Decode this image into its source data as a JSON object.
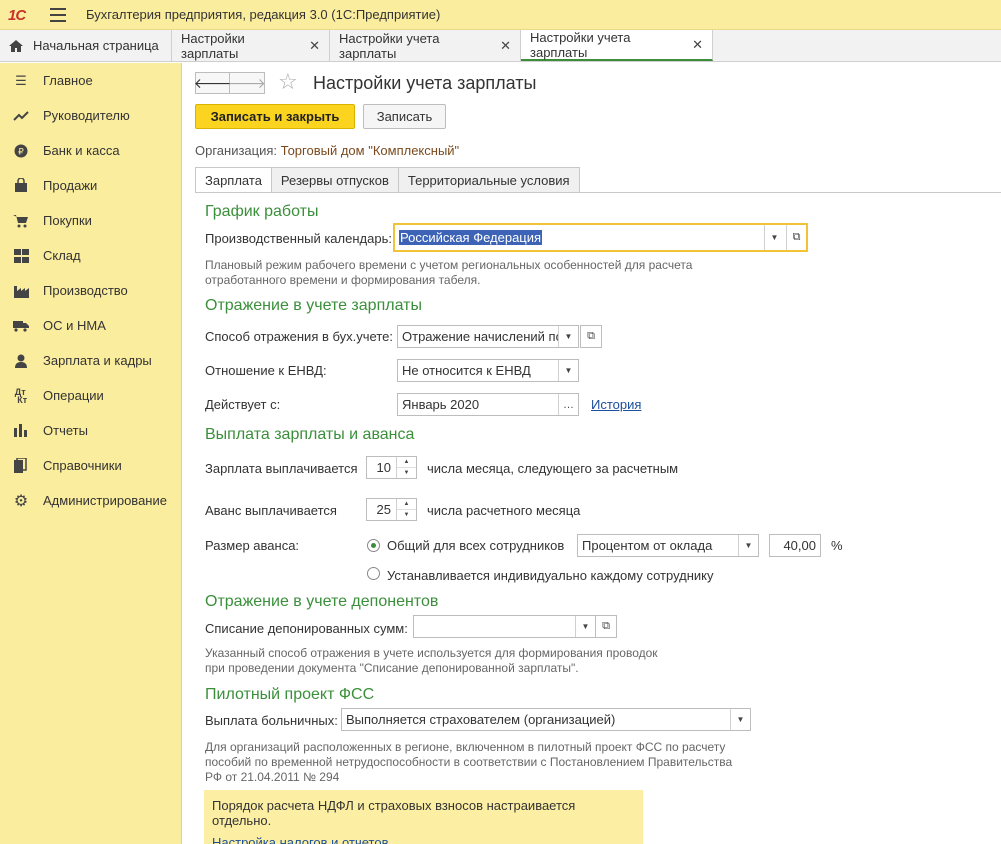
{
  "app": {
    "logo": "1С",
    "title": "Бухгалтерия предприятия, редакция 3.0  (1С:Предприятие)"
  },
  "tabs": [
    {
      "label": "Начальная страница"
    },
    {
      "label": "Настройки зарплаты"
    },
    {
      "label": "Настройки учета зарплаты"
    },
    {
      "label": "Настройки учета зарплаты"
    }
  ],
  "sidebar": {
    "items": [
      {
        "label": "Главное",
        "icon": "menu-list-icon"
      },
      {
        "label": "Руководителю",
        "icon": "trend-icon"
      },
      {
        "label": "Банк и касса",
        "icon": "ruble-icon"
      },
      {
        "label": "Продажи",
        "icon": "shopping-bag-icon"
      },
      {
        "label": "Покупки",
        "icon": "cart-icon"
      },
      {
        "label": "Склад",
        "icon": "warehouse-icon"
      },
      {
        "label": "Производство",
        "icon": "factory-icon"
      },
      {
        "label": "ОС и НМА",
        "icon": "truck-icon"
      },
      {
        "label": "Зарплата и кадры",
        "icon": "person-icon"
      },
      {
        "label": "Операции",
        "icon": "dt-kt-icon"
      },
      {
        "label": "Отчеты",
        "icon": "bar-chart-icon"
      },
      {
        "label": "Справочники",
        "icon": "books-icon"
      },
      {
        "label": "Администрирование",
        "icon": "gear-icon"
      }
    ]
  },
  "page": {
    "title": "Настройки учета зарплаты",
    "save_close_label": "Записать и закрыть",
    "save_label": "Записать",
    "org_label": "Организация:",
    "org_value": "Торговый дом \"Комплексный\""
  },
  "form_tabs": [
    "Зарплата",
    "Резервы отпусков",
    "Территориальные условия"
  ],
  "schedule": {
    "title": "График работы",
    "calendar_label": "Производственный календарь:",
    "calendar_value": "Российская Федерация",
    "hint_1": "Плановый режим рабочего времени с учетом региональных особенностей для расчета",
    "hint_2": "отработанного времени и формирования табеля."
  },
  "accounting": {
    "title": "Отражение в учете зарплаты",
    "method_label": "Способ отражения в бух.учете:",
    "method_value": "Отражение начислений по",
    "envd_label": "Отношение к ЕНВД:",
    "envd_value": "Не относится к ЕНВД",
    "from_label": "Действует с:",
    "from_value": "Январь 2020",
    "history_link": "История"
  },
  "payment": {
    "title": "Выплата зарплаты и аванса",
    "salary_label": "Зарплата выплачивается",
    "salary_day": "10",
    "salary_suffix": "числа месяца, следующего за расчетным",
    "advance_label": "Аванс выплачивается",
    "advance_day": "25",
    "advance_suffix": "числа расчетного месяца",
    "size_label": "Размер аванса:",
    "option_common": "Общий для всех сотрудников",
    "option_individual": "Устанавливается индивидуально каждому сотруднику",
    "method_value": "Процентом от оклада",
    "percent_value": "40,00",
    "percent_sign": "%"
  },
  "deponents": {
    "title": "Отражение в учете депонентов",
    "writeoff_label": "Списание депонированных сумм:",
    "writeoff_value": "",
    "hint_1": "Указанный способ отражения в учете используется для формирования проводок",
    "hint_2": "при проведении документа \"Списание депонированной зарплаты\"."
  },
  "fss": {
    "title": "Пилотный проект ФСС",
    "sick_label": "Выплата больничных:",
    "sick_value": "Выполняется страхователем (организацией)",
    "hint_1": "Для организаций расположенных в регионе, включенном в пилотный проект ФСС по расчету",
    "hint_2": "пособий по временной нетрудоспособности в соответствии с Постановлением Правительства",
    "hint_3": "РФ от 21.04.2011 № 294"
  },
  "notice": {
    "text": "Порядок расчета НДФЛ и страховых взносов настраивается отдельно.",
    "link": "Настройка налогов и отчетов"
  },
  "colors": {
    "accent_yellow": "#fad41f",
    "sidebar_bg": "#fbed9e",
    "section_green": "#3b8f3b",
    "link_blue": "#1a4f9c"
  }
}
